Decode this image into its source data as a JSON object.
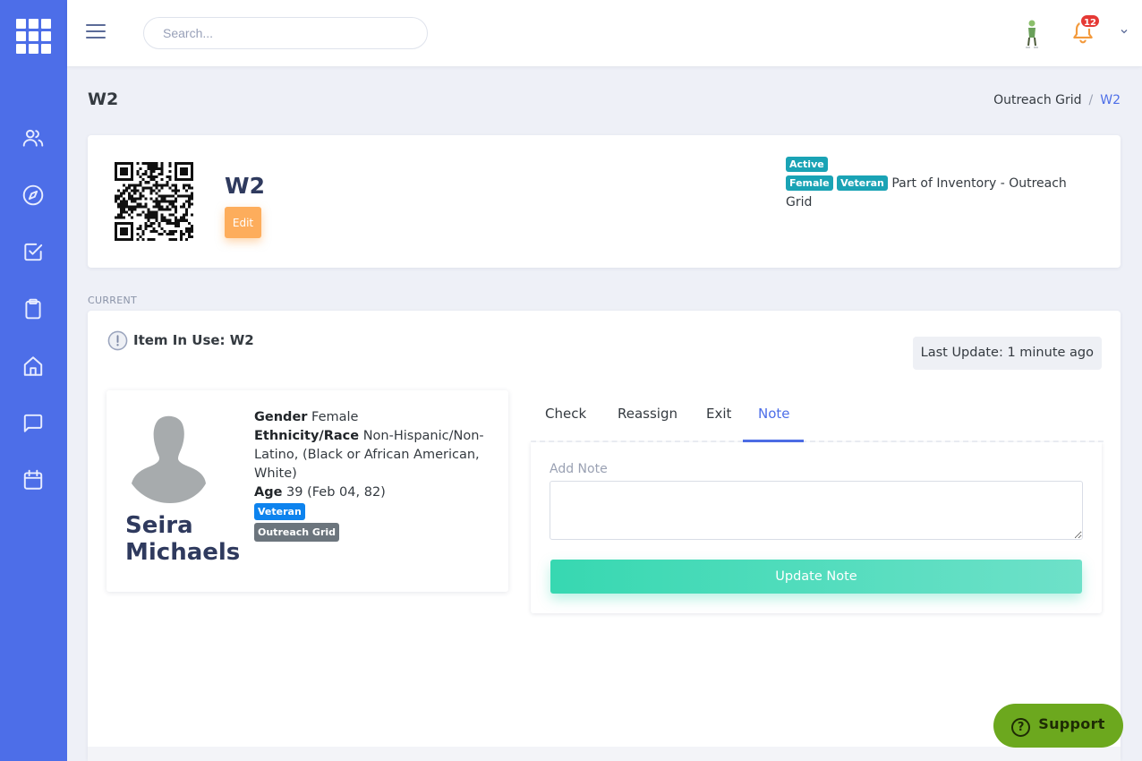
{
  "topbar": {
    "search_placeholder": "Search...",
    "notification_count": "12"
  },
  "page": {
    "title": "W2",
    "breadcrumb": {
      "parent": "Outreach Grid",
      "separator": "/",
      "current": "W2"
    }
  },
  "item": {
    "name": "W2",
    "edit_label": "Edit",
    "status_badge": "Active",
    "tags": [
      "Female",
      "Veteran"
    ],
    "inventory_text": "Part of Inventory - Outreach Grid"
  },
  "current": {
    "section_label": "CURRENT",
    "title": "Item In Use: W2",
    "last_update": "Last Update: 1 minute ago"
  },
  "person": {
    "name": "Seira Michaels",
    "gender_label": "Gender",
    "gender": "Female",
    "ethnicity_label": "Ethnicity/Race",
    "ethnicity": "Non-Hispanic/Non-Latino, (Black or African American, White)",
    "age_label": "Age",
    "age": "39 (Feb 04, 82)",
    "badge_veteran": "Veteran",
    "badge_group": "Outreach Grid"
  },
  "tabs": [
    "Check",
    "Reassign",
    "Exit",
    "Note"
  ],
  "active_tab": "Note",
  "note": {
    "label": "Add Note",
    "value": "",
    "submit_label": "Update Note"
  },
  "support": {
    "label": "Support",
    "icon": "?"
  },
  "colors": {
    "sidebar": "#4d6ee8",
    "accent": "#4d6ee8",
    "edit": "#fdad5c",
    "teal_badge": "#1aa3b5",
    "blue_badge": "#0d83ee",
    "update_button": "#37d8b1",
    "support": "#6ca81e"
  },
  "icons": {
    "sidebar": [
      "apps-grid-icon",
      "users-icon",
      "compass-icon",
      "checkbox-icon",
      "clipboard-icon",
      "home-icon",
      "message-icon",
      "calendar-icon"
    ],
    "top": [
      "menu-icon",
      "user-avatar-icon",
      "bell-icon",
      "chevron-down-icon"
    ]
  }
}
